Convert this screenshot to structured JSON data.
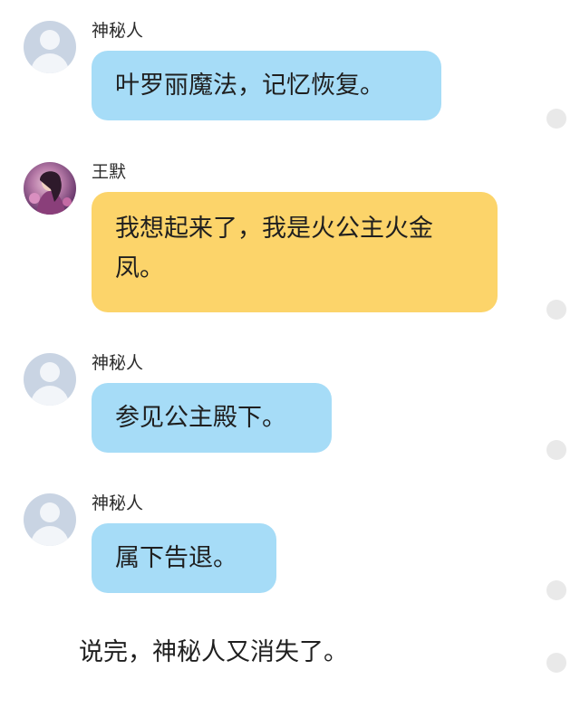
{
  "messages": [
    {
      "sender": "神秘人",
      "avatar": "default-avatar",
      "text": "叶罗丽魔法，记忆恢复。",
      "bubble_color": "#a6dcf7"
    },
    {
      "sender": "王默",
      "avatar": "photo-avatar",
      "text": "我想起来了，我是火公主火金凤。",
      "bubble_color": "#fcd46a"
    },
    {
      "sender": "神秘人",
      "avatar": "default-avatar",
      "text": "参见公主殿下。",
      "bubble_color": "#a6dcf7"
    },
    {
      "sender": "神秘人",
      "avatar": "default-avatar",
      "text": "属下告退。",
      "bubble_color": "#a6dcf7"
    }
  ],
  "narration": "说完，神秘人又消失了。",
  "colors": {
    "blue_bubble": "#a6dcf7",
    "yellow_bubble": "#fcd46a",
    "indicator_dot": "#e9e9e9"
  }
}
